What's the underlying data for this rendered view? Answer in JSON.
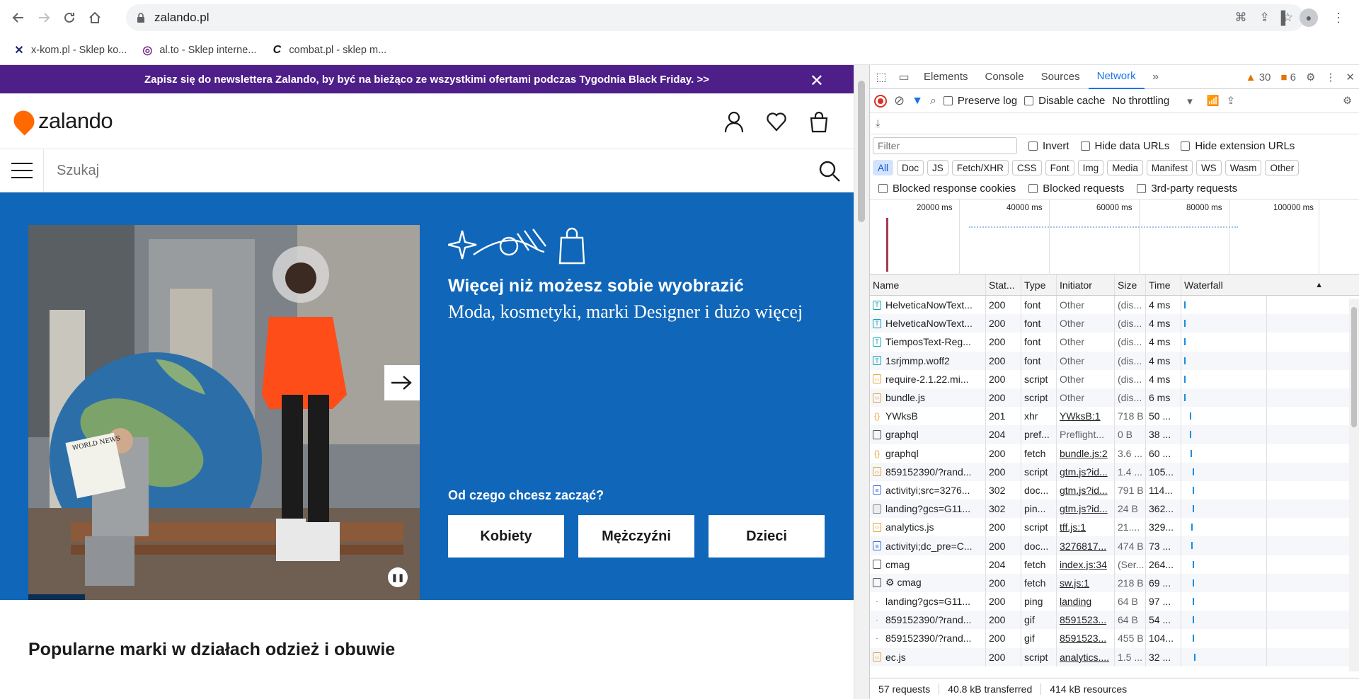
{
  "browser": {
    "url": "zalando.pl",
    "bookmarks": [
      {
        "label": "x-kom.pl - Sklep ko...",
        "icon": "x-kom-icon"
      },
      {
        "label": "al.to - Sklep interne...",
        "icon": "alto-icon"
      },
      {
        "label": "combat.pl - sklep m...",
        "icon": "combat-icon"
      }
    ]
  },
  "page": {
    "promo": "Zapisz się do newslettera Zalando, by być na bieżąco ze wszystkimi ofertami podczas Tygodnia Black Friday. >>",
    "logo": "zalando",
    "search_placeholder": "Szukaj",
    "hero": {
      "title": "Więcej niż możesz sobie wyobrazić",
      "subtitle": "Moda, kosmetyki, marki Designer i dużo więcej",
      "question": "Od czego chcesz zacząć?",
      "buttons": [
        "Kobiety",
        "Mężczyźni",
        "Dzieci"
      ],
      "newspaper": "WORLD NEWS"
    },
    "popular_heading": "Popularne marki w działach odzież i obuwie"
  },
  "devtools": {
    "tabs": [
      "Elements",
      "Console",
      "Sources",
      "Network"
    ],
    "active_tab": "Network",
    "warnings": "30",
    "issues": "6",
    "preserve_log": "Preserve log",
    "disable_cache": "Disable cache",
    "throttling": "No throttling",
    "filter_placeholder": "Filter",
    "invert": "Invert",
    "hide_data_urls": "Hide data URLs",
    "hide_ext_urls": "Hide extension URLs",
    "type_filters": [
      "All",
      "Doc",
      "JS",
      "Fetch/XHR",
      "CSS",
      "Font",
      "Img",
      "Media",
      "Manifest",
      "WS",
      "Wasm",
      "Other"
    ],
    "blocked_cookies": "Blocked response cookies",
    "blocked_requests": "Blocked requests",
    "third_party": "3rd-party requests",
    "timeline_ticks": [
      "20000 ms",
      "40000 ms",
      "60000 ms",
      "80000 ms",
      "100000 ms"
    ],
    "columns": [
      "Name",
      "Stat...",
      "Type",
      "Initiator",
      "Size",
      "Time",
      "Waterfall"
    ],
    "rows": [
      {
        "name": "HelveticaNowText...",
        "status": "200",
        "type": "font",
        "initiator": "Other",
        "size": "(dis...",
        "time": "4 ms",
        "icon": "font",
        "link": false
      },
      {
        "name": "HelveticaNowText...",
        "status": "200",
        "type": "font",
        "initiator": "Other",
        "size": "(dis...",
        "time": "4 ms",
        "icon": "font",
        "link": false
      },
      {
        "name": "TiemposText-Reg...",
        "status": "200",
        "type": "font",
        "initiator": "Other",
        "size": "(dis...",
        "time": "4 ms",
        "icon": "font",
        "link": false
      },
      {
        "name": "1srjmmp.woff2",
        "status": "200",
        "type": "font",
        "initiator": "Other",
        "size": "(dis...",
        "time": "4 ms",
        "icon": "font",
        "link": false
      },
      {
        "name": "require-2.1.22.mi...",
        "status": "200",
        "type": "script",
        "initiator": "Other",
        "size": "(dis...",
        "time": "4 ms",
        "icon": "script",
        "link": false
      },
      {
        "name": "bundle.js",
        "status": "200",
        "type": "script",
        "initiator": "Other",
        "size": "(dis...",
        "time": "6 ms",
        "icon": "script",
        "link": false
      },
      {
        "name": "YWksB",
        "status": "201",
        "type": "xhr",
        "initiator": "YWksB:1",
        "size": "718 B",
        "time": "50 ...",
        "icon": "xhr",
        "link": true
      },
      {
        "name": "graphql",
        "status": "204",
        "type": "pref...",
        "initiator": "Preflight...",
        "size": "0 B",
        "time": "38 ...",
        "icon": "other",
        "link": false
      },
      {
        "name": "graphql",
        "status": "200",
        "type": "fetch",
        "initiator": "bundle.js:2",
        "size": "3.6 ...",
        "time": "60 ...",
        "icon": "xhr",
        "link": true
      },
      {
        "name": "859152390/?rand...",
        "status": "200",
        "type": "script",
        "initiator": "gtm.js?id...",
        "size": "1.4 ...",
        "time": "105...",
        "icon": "script",
        "link": true
      },
      {
        "name": "activityi;src=3276...",
        "status": "302",
        "type": "doc...",
        "initiator": "gtm.js?id...",
        "size": "791 B",
        "time": "114...",
        "icon": "doc",
        "link": true
      },
      {
        "name": "landing?gcs=G11...",
        "status": "302",
        "type": "pin...",
        "initiator": "gtm.js?id...",
        "size": "24 B",
        "time": "362...",
        "icon": "img",
        "link": true
      },
      {
        "name": "analytics.js",
        "status": "200",
        "type": "script",
        "initiator": "tff.js:1",
        "size": "21....",
        "time": "329...",
        "icon": "script",
        "link": true
      },
      {
        "name": "activityi;dc_pre=C...",
        "status": "200",
        "type": "doc...",
        "initiator": "3276817...",
        "size": "474 B",
        "time": "73 ...",
        "icon": "doc",
        "link": true
      },
      {
        "name": "cmag",
        "status": "204",
        "type": "fetch",
        "initiator": "index.js:34",
        "size": "(Ser...",
        "time": "264...",
        "icon": "other",
        "link": true
      },
      {
        "name": "⚙ cmag",
        "status": "200",
        "type": "fetch",
        "initiator": "sw.js:1",
        "size": "218 B",
        "time": "69 ...",
        "icon": "other",
        "link": true
      },
      {
        "name": "landing?gcs=G11...",
        "status": "200",
        "type": "ping",
        "initiator": "landing",
        "size": "64 B",
        "time": "97 ...",
        "icon": "none",
        "link": true
      },
      {
        "name": "859152390/?rand...",
        "status": "200",
        "type": "gif",
        "initiator": "8591523...",
        "size": "64 B",
        "time": "54 ...",
        "icon": "none",
        "link": true
      },
      {
        "name": "859152390/?rand...",
        "status": "200",
        "type": "gif",
        "initiator": "8591523...",
        "size": "455 B",
        "time": "104...",
        "icon": "none",
        "link": true
      },
      {
        "name": "ec.js",
        "status": "200",
        "type": "script",
        "initiator": "analytics....",
        "size": "1.5 ...",
        "time": "32 ...",
        "icon": "script",
        "link": true
      }
    ],
    "status": {
      "requests": "57 requests",
      "transferred": "40.8 kB transferred",
      "resources": "414 kB resources"
    }
  }
}
